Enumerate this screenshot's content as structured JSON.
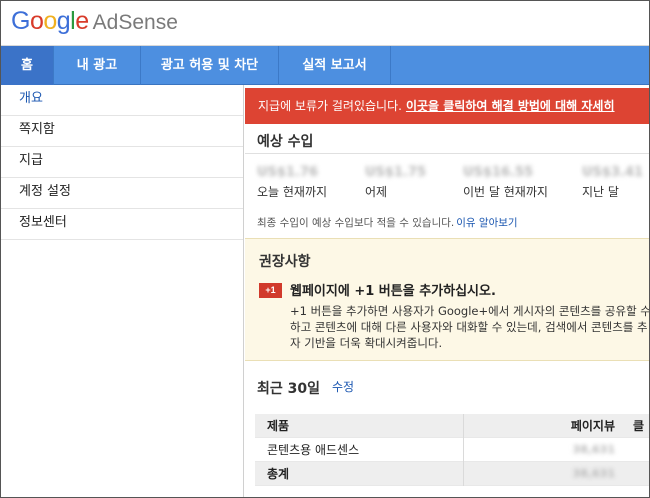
{
  "logo": {
    "g1": "G",
    "g2": "o",
    "g3": "o",
    "g4": "g",
    "g5": "l",
    "g6": "e",
    "product": "AdSense"
  },
  "nav": {
    "tabs": [
      {
        "label": "홈"
      },
      {
        "label": "내 광고"
      },
      {
        "label": "광고 허용 및 차단"
      },
      {
        "label": "실적 보고서"
      }
    ]
  },
  "sidebar": {
    "items": [
      {
        "label": "개요"
      },
      {
        "label": "쪽지함"
      },
      {
        "label": "지급"
      },
      {
        "label": "계정 설정"
      },
      {
        "label": "정보센터"
      }
    ]
  },
  "alert": {
    "text": "지급에 보류가 걸려있습니다.",
    "link": "이곳을 클릭하여 해결 방법에 대해 자세히"
  },
  "earnings": {
    "title": "예상 수입",
    "columns": [
      {
        "amount": "US$1.76",
        "label": "오늘 현재까지"
      },
      {
        "amount": "US$1.75",
        "label": "어제"
      },
      {
        "amount": "US$16.55",
        "label": "이번 달 현재까지"
      },
      {
        "amount": "US$3.41",
        "label": "지난 달"
      }
    ],
    "note": "최종 수입이 예상 수입보다 적을 수 있습니다.",
    "note_link": "이유 알아보기"
  },
  "recommendations": {
    "title": "권장사항",
    "badge": "+1",
    "heading": "웹페이지에 +1 버튼을 추가하십시오.",
    "body_line1": "+1 버튼을 추가하면 사용자가 Google+에서 게시자의 콘텐츠를 공유할 수",
    "body_line2": "하고 콘텐츠에 대해 다른 사용자와 대화할 수 있는데, 검색에서 콘텐츠를 추",
    "body_line3": "자 기반을 더욱 확대시켜줍니다."
  },
  "recent": {
    "title": "최근 30일",
    "edit": "수정",
    "table": {
      "headers": {
        "product": "제품",
        "pageviews": "페이지뷰",
        "extra": "클"
      },
      "rows": [
        {
          "product": "콘텐츠용 애드센스",
          "pageviews": "38,631"
        }
      ],
      "total": {
        "product": "총계",
        "pageviews": "38,631"
      }
    }
  },
  "colors": {
    "nav_bg": "#4d8fe0",
    "nav_active": "#3b73c8",
    "alert_bg": "#dd4433",
    "reco_bg": "#fdf8e6",
    "link": "#1a56b0"
  }
}
